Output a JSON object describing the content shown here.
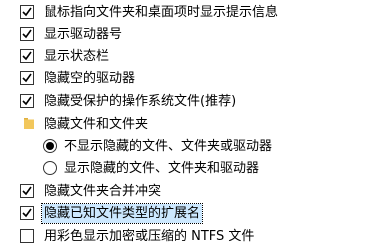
{
  "advanced_settings": {
    "items": [
      {
        "label": "鼠标指向文件夹和桌面项时显示提示信息",
        "checked": true
      },
      {
        "label": "显示驱动器号",
        "checked": true
      },
      {
        "label": "显示状态栏",
        "checked": true
      },
      {
        "label": "隐藏空的驱动器",
        "checked": true
      },
      {
        "label": "隐藏受保护的操作系统文件(推荐)",
        "checked": true
      }
    ],
    "hidden_files_group": {
      "label": "隐藏文件和文件夹",
      "options": [
        {
          "label": "不显示隐藏的文件、文件夹或驱动器",
          "selected": true
        },
        {
          "label": "显示隐藏的文件、文件夹和驱动器",
          "selected": false
        }
      ]
    },
    "items_after": [
      {
        "label": "隐藏文件夹合并冲突",
        "checked": true
      },
      {
        "label": "隐藏已知文件类型的扩展名",
        "checked": true,
        "focused": true
      },
      {
        "label": "用彩色显示加密或压缩的 NTFS 文件",
        "checked": false
      }
    ]
  },
  "colors": {
    "selection_highlight": "#cce8ff",
    "folder_icon": "#f2c75c"
  }
}
